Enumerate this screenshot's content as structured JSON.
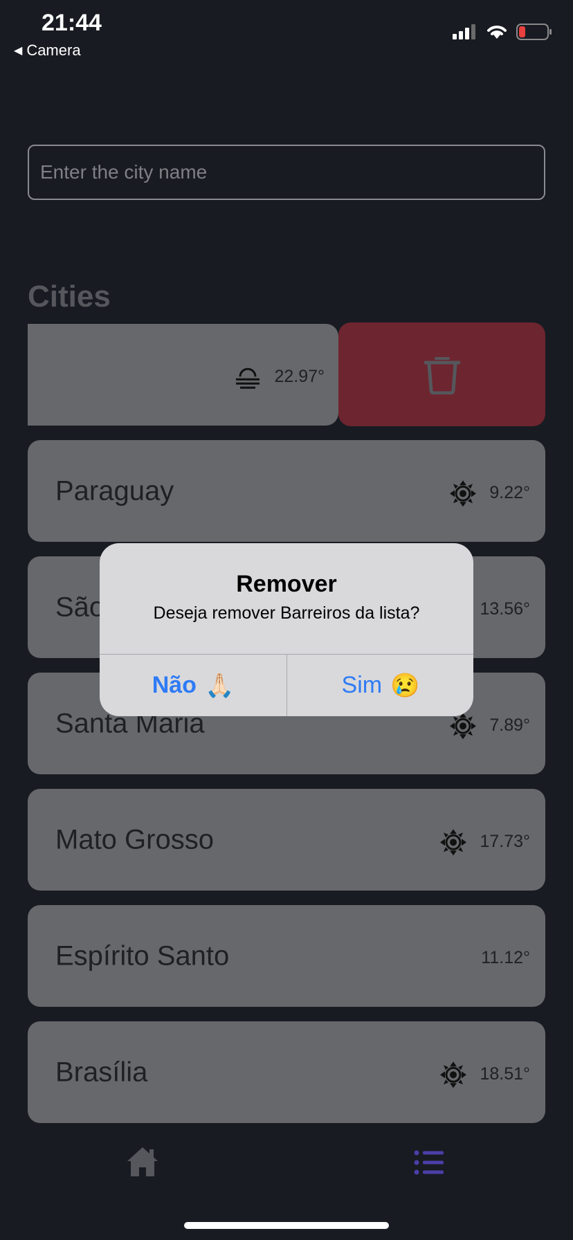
{
  "status_bar": {
    "time": "21:44",
    "back_app": "Camera",
    "icons": [
      "signal-icon",
      "wifi-icon",
      "battery-low-icon"
    ]
  },
  "search": {
    "placeholder": "Enter the city name",
    "value": ""
  },
  "section_title": "Cities",
  "swiped_card": {
    "temp": "22.97°",
    "icon": "fog-icon"
  },
  "cities": [
    {
      "name": "Paraguay",
      "temp": "9.22°",
      "icon": "sun-icon"
    },
    {
      "name": "São",
      "temp": "13.56°",
      "icon": ""
    },
    {
      "name": "Santa Maria",
      "temp": "7.89°",
      "icon": "sun-icon"
    },
    {
      "name": "Mato Grosso",
      "temp": "17.73°",
      "icon": "sun-icon"
    },
    {
      "name": "Espírito Santo",
      "temp": "11.12°",
      "icon": ""
    },
    {
      "name": "Brasília",
      "temp": "18.51°",
      "icon": "sun-icon"
    }
  ],
  "alert": {
    "title": "Remover",
    "message": "Deseja remover Barreiros da lista?",
    "no_label": "Não",
    "no_emoji": "🙏🏻",
    "yes_label": "Sim",
    "yes_emoji": "😢"
  },
  "tabbar": {
    "items": [
      "home-icon",
      "list-icon"
    ],
    "active": "list-icon"
  },
  "colors": {
    "background": "#181b22",
    "card": "#67686c",
    "delete": "#6d252f",
    "alert_button": "#2f7bf5",
    "active_tab": "#4b3fa8"
  }
}
